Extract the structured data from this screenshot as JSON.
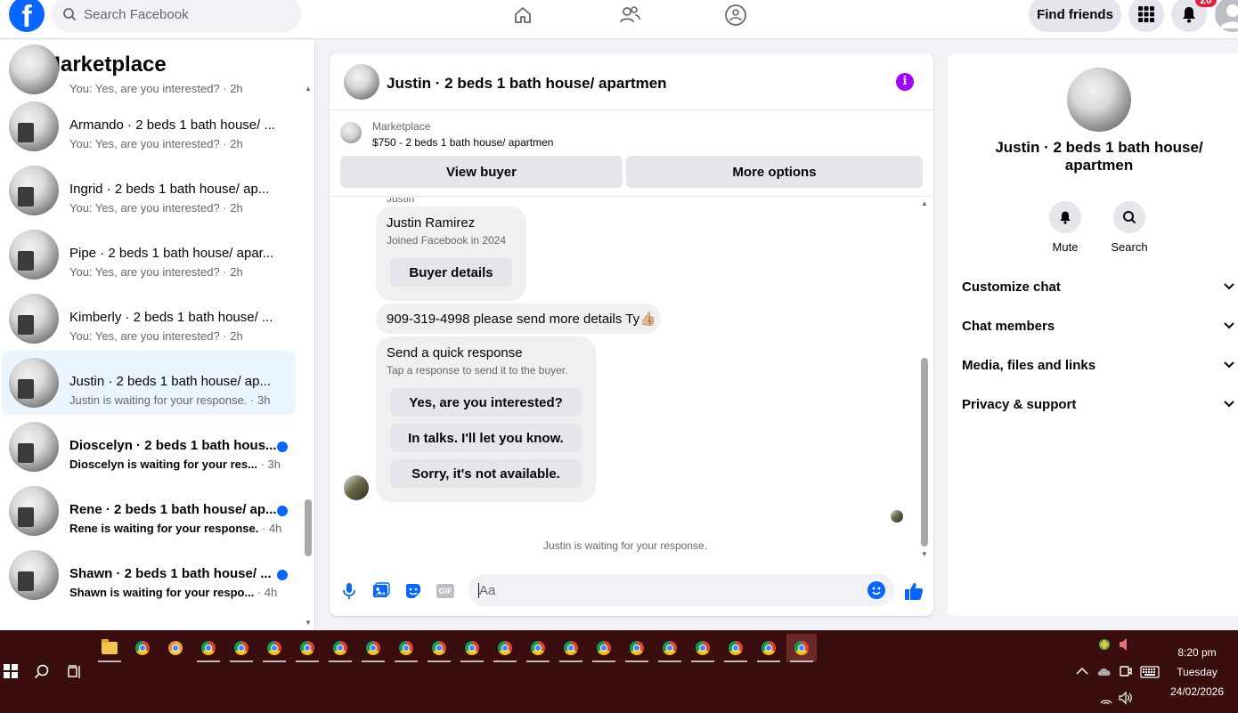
{
  "topbar": {
    "logo": "f",
    "search_placeholder": "Search Facebook",
    "find_friends": "Find friends",
    "notification_count": "20",
    "icons": [
      "home-icon",
      "friends-icon",
      "groups-icon",
      "menu-grid-icon",
      "bell-icon",
      "profile-avatar"
    ]
  },
  "sidebar": {
    "title": "Marketplace",
    "first_partial_sub": "You: Yes, are you interested? · 2h",
    "conversations": [
      {
        "name": "Armando · 2 beds 1 bath house/ ...",
        "preview": "You: Yes, are you interested?",
        "time": "2h",
        "unread": false,
        "active": false
      },
      {
        "name": "Ingrid · 2 beds 1 bath house/ ap...",
        "preview": "You: Yes, are you interested?",
        "time": "2h",
        "unread": false,
        "active": false
      },
      {
        "name": "Pipe · 2 beds 1 bath house/ apar...",
        "preview": "You: Yes, are you interested?",
        "time": "2h",
        "unread": false,
        "active": false
      },
      {
        "name": "Kimberly · 2 beds 1 bath house/ ...",
        "preview": "You: Yes, are you interested?",
        "time": "2h",
        "unread": false,
        "active": false
      },
      {
        "name": "Justin · 2 beds 1 bath house/ ap...",
        "preview": "Justin is waiting for your response.",
        "time": "3h",
        "unread": false,
        "active": true
      },
      {
        "name": "Dioscelyn · 2 beds 1 bath hous...",
        "preview": "Dioscelyn is waiting for your res...",
        "time": "3h",
        "unread": true,
        "active": false
      },
      {
        "name": "Rene · 2 beds 1 bath house/ ap...",
        "preview": "Rene is waiting for your response.",
        "time": "4h",
        "unread": true,
        "active": false
      },
      {
        "name": "Shawn · 2 beds 1 bath house/ ...",
        "preview": "Shawn is waiting for your respo...",
        "time": "4h",
        "unread": true,
        "active": false
      }
    ]
  },
  "chat": {
    "title": "Justin · 2 beds 1 bath house/ apartmen",
    "info_icon": "i",
    "listing": {
      "label": "Marketplace",
      "price_title": "$750 - 2 beds 1 bath house/ apartmen",
      "view_buyer": "View buyer",
      "more_options": "More options"
    },
    "sender_label": "Justin",
    "profile_card": {
      "name": "Justin Ramirez",
      "joined": "Joined Facebook in 2024",
      "button": "Buyer details"
    },
    "message": "909-319-4998 please send more details Ty👍🏼",
    "quick_response": {
      "title": "Send a quick response",
      "subtitle": "Tap a response to send it to the buyer.",
      "options": [
        "Yes, are you interested?",
        "In talks. I'll let you know.",
        "Sorry, it's not available."
      ]
    },
    "waiting_text": "Justin is waiting for your response.",
    "composer_placeholder": "Aa",
    "composer_icons": [
      "microphone-icon",
      "photo-icon",
      "sticker-icon",
      "gif-icon",
      "emoji-icon",
      "like-icon"
    ],
    "gif_label": "GIF"
  },
  "details": {
    "name": "Justin · 2 beds 1 bath house/ apartmen",
    "actions": [
      {
        "label": "Mute",
        "icon": "bell-icon"
      },
      {
        "label": "Search",
        "icon": "search-icon"
      }
    ],
    "sections": [
      "Customize chat",
      "Chat members",
      "Media, files and links",
      "Privacy & support"
    ]
  },
  "taskbar": {
    "time": "8:20 pm",
    "day": "Tuesday",
    "date": "24/02/2026",
    "chrome_windows": 19
  },
  "colors": {
    "accent": "#0866ff",
    "info": "#a200ff",
    "unread_dot": "#0866ff",
    "badge": "#e41e3f",
    "taskbar": "#3a0e0e"
  }
}
